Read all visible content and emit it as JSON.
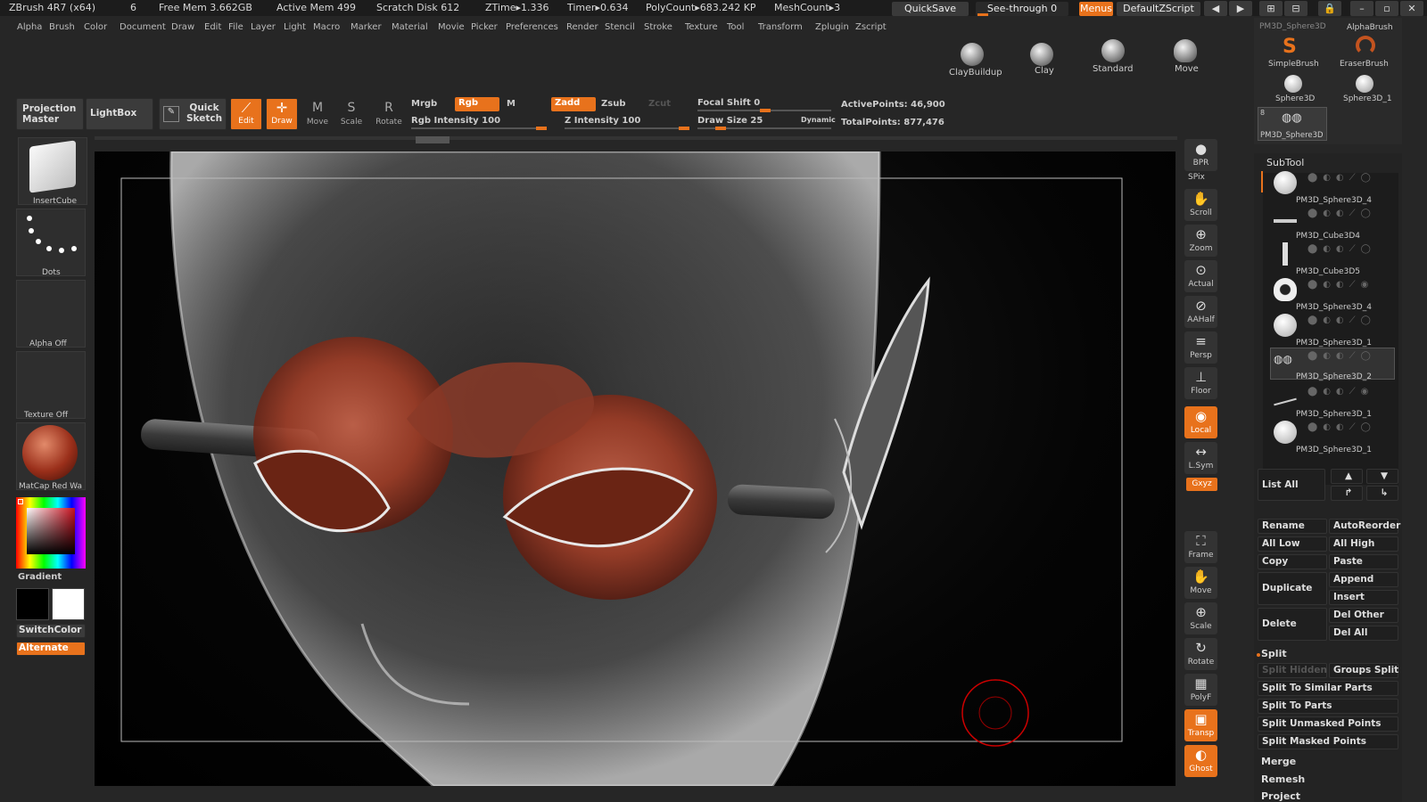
{
  "title_bar": {
    "app": "ZBrush 4R7 (x64)",
    "num": "6",
    "free_mem": "Free Mem 3.662GB",
    "active_mem": "Active Mem 499",
    "scratch": "Scratch Disk 612",
    "ztime": "ZTime▸1.336",
    "timer": "Timer▸0.634",
    "polycount": "PolyCount▸683.242 KP",
    "meshcount": "MeshCount▸3",
    "quicksave": "QuickSave",
    "see_through": "See-through  0",
    "menus": "Menus",
    "script": "DefaultZScript"
  },
  "menu": [
    "Alpha",
    "Brush",
    "Color",
    "Document",
    "Draw",
    "Edit",
    "File",
    "Layer",
    "Light",
    "Macro",
    "Marker",
    "Material",
    "Movie",
    "Picker",
    "Preferences",
    "Render",
    "Stencil",
    "Stroke",
    "Texture",
    "Tool",
    "Transform",
    "Zplugin",
    "Zscript"
  ],
  "brushes": [
    "ClayBuildup",
    "Clay",
    "Standard",
    "Move"
  ],
  "toolbar": {
    "projection": "Projection Master",
    "lightbox": "LightBox",
    "quick_sketch": "Quick Sketch",
    "edit": "Edit",
    "draw": "Draw",
    "move": "Move",
    "scale": "Scale",
    "rotate": "Rotate",
    "mrgb": "Mrgb",
    "rgb": "Rgb",
    "m": "M",
    "zadd": "Zadd",
    "zsub": "Zsub",
    "zcut": "Zcut",
    "rgb_intensity": "Rgb  Intensity 100",
    "z_intensity": "Z  Intensity 100",
    "focal_shift": "Focal  Shift  0",
    "draw_size": "Draw  Size  25",
    "dynamic": "Dynamic",
    "active_points": "ActivePoints: 46,900",
    "total_points": "TotalPoints: 877,476"
  },
  "left": {
    "insertcube": "InsertCube",
    "dots": "Dots",
    "alpha": "Alpha  Off",
    "texture": "Texture  Off",
    "matcap": "MatCap  Red  Wa",
    "gradient": "Gradient",
    "switchcolor": "SwitchColor",
    "alternate": "Alternate"
  },
  "right_tools": [
    "BPR",
    "SPix",
    "Scroll",
    "Zoom",
    "Actual",
    "AAHalf",
    "Persp",
    "Floor",
    "Local",
    "L.Sym",
    "Gxyz",
    "Frame",
    "Move",
    "Scale",
    "Rotate",
    "PolyF",
    "Transp",
    "Ghost"
  ],
  "tool_palette": {
    "top": "PM3D_Sphere3D",
    "items": [
      "SimpleBrush",
      "EraserBrush",
      "Sphere3D",
      "Sphere3D_1"
    ],
    "alpha_brush": "AlphaBrush",
    "selected": "PM3D_Sphere3D",
    "sel_count": "8"
  },
  "subtool": {
    "title": "SubTool",
    "items": [
      "PM3D_Sphere3D_4",
      "PM3D_Cube3D4",
      "PM3D_Cube3D5",
      "PM3D_Sphere3D_4",
      "PM3D_Sphere3D_1",
      "PM3D_Sphere3D_2",
      "PM3D_Sphere3D_1",
      "PM3D_Sphere3D_1"
    ],
    "list_all": "List  All",
    "buttons": {
      "rename": "Rename",
      "autoreorder": "AutoReorder",
      "all_low": "All  Low",
      "all_high": "All  High",
      "copy": "Copy",
      "paste": "Paste",
      "duplicate": "Duplicate",
      "append": "Append",
      "insert": "Insert",
      "delete": "Delete",
      "del_other": "Del  Other",
      "del_all": "Del  All"
    },
    "split": "Split",
    "split_hidden": "Split  Hidden",
    "groups_split": "Groups  Split",
    "split_similar": "Split  To  Similar  Parts",
    "split_parts": "Split  To  Parts",
    "split_unmasked": "Split  Unmasked  Points",
    "split_masked": "Split  Masked  Points",
    "merge": "Merge",
    "remesh": "Remesh",
    "project": "Project"
  },
  "colors": {
    "accent": "#e8721c",
    "bg": "#262626",
    "panel": "#1f1f1f",
    "eye": "#b5482c"
  }
}
